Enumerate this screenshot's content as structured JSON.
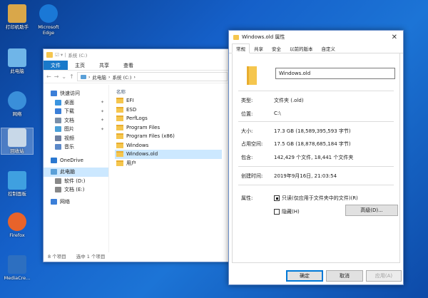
{
  "desktop": {
    "icons": [
      {
        "label": "打印机助手",
        "color": "#d9a74a"
      },
      {
        "label": "Microsoft Edge",
        "color": "#1a78d6"
      },
      {
        "label": "此电脑",
        "color": "#6fb5e8"
      },
      {
        "label": "网络",
        "color": "#3a8fd9"
      },
      {
        "label": "回收站",
        "color": "#c8d8e8"
      },
      {
        "label": "控制面板",
        "color": "#3fa0e0"
      },
      {
        "label": "Firefox",
        "color": "#e8632a"
      },
      {
        "label": "MediaCre...",
        "color": "#2d6fc0"
      }
    ]
  },
  "explorer": {
    "title": "系统 (C:)",
    "ribbon": [
      "文件",
      "主页",
      "共享",
      "查看"
    ],
    "breadcrumb": [
      "此电脑",
      "系统 (C:)"
    ],
    "nav": [
      {
        "label": "快速访问",
        "color": "#3b7fd8"
      },
      {
        "label": "桌面",
        "color": "#3b95e0",
        "pin": "true"
      },
      {
        "label": "下载",
        "color": "#3b7fd8",
        "pin": "true"
      },
      {
        "label": "文档",
        "color": "#7a8fa8",
        "pin": "true"
      },
      {
        "label": "图片",
        "color": "#4aa0d8",
        "pin": "true"
      },
      {
        "label": "视频",
        "color": "#6d7fa0"
      },
      {
        "label": "音乐",
        "color": "#5b88c8"
      },
      {
        "label": "OneDrive",
        "color": "#2a78d0"
      },
      {
        "label": "此电脑",
        "color": "#5aa0d8"
      },
      {
        "label": "软件 (D:)",
        "color": "#888888"
      },
      {
        "label": "文档 (E:)",
        "color": "#888888"
      },
      {
        "label": "网络",
        "color": "#3b7fd8"
      }
    ],
    "column_name": "名称",
    "files": [
      "EFI",
      "ESD",
      "PerfLogs",
      "Program Files",
      "Program Files (x86)",
      "Windows",
      "Windows.old",
      "用户"
    ],
    "status_count": "8 个项目",
    "status_selected": "选中 1 个项目"
  },
  "dialog": {
    "title": "Windows.old 属性",
    "close": "✕",
    "tabs": [
      "常规",
      "共享",
      "安全",
      "以前的版本",
      "自定义"
    ],
    "name": "Windows.old",
    "type_k": "类型:",
    "type_v": "文件夹 (.old)",
    "loc_k": "位置:",
    "loc_v": "C:\\",
    "size_k": "大小:",
    "size_v": "17.3 GB (18,589,395,593 字节)",
    "disk_k": "占用空间:",
    "disk_v": "17.5 GB (18,878,685,184 字节)",
    "contains_k": "包含:",
    "contains_v": "142,429 个文件, 18,441 个文件夹",
    "created_k": "创建时间:",
    "created_v": "2019年9月16日, 21:03:54",
    "attr_k": "属性:",
    "readonly": "只读(仅应用于文件夹中的文件)(R)",
    "hidden": "隐藏(H)",
    "advanced": "高级(D)...",
    "ok": "确定",
    "cancel": "取消",
    "apply": "应用(A)"
  }
}
